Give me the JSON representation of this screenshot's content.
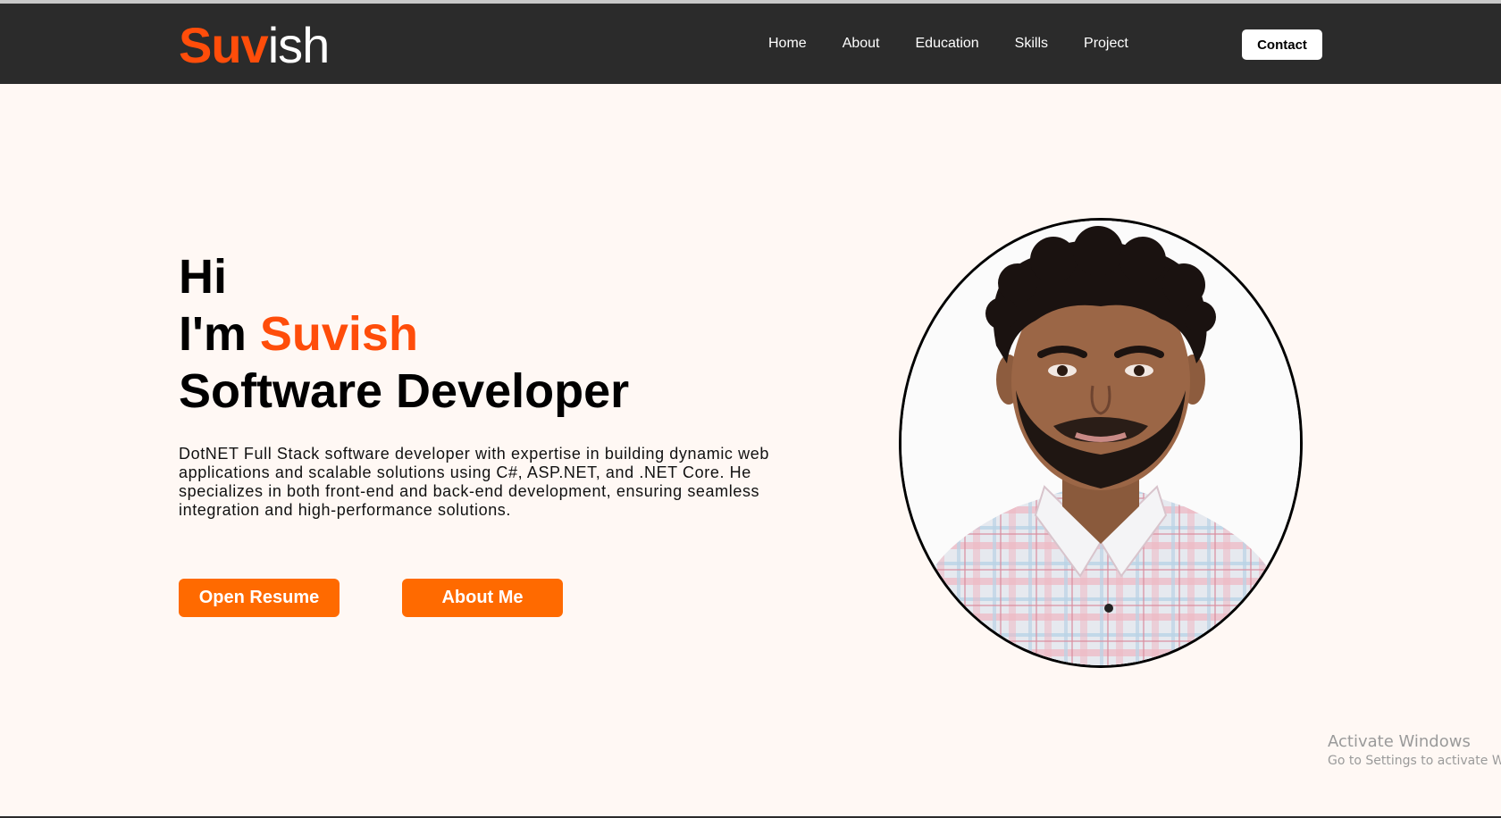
{
  "header": {
    "logo_accent": "Suv",
    "logo_rest": "ish",
    "nav": [
      "Home",
      "About",
      "Education",
      "Skills",
      "Project"
    ],
    "contact_label": "Contact"
  },
  "hero": {
    "greeting": "Hi",
    "im": "I'm ",
    "name": "Suvish",
    "role": "Software Developer",
    "description": "DotNET Full Stack software developer with expertise in building dynamic web applications and scalable solutions using C#, ASP.NET, and .NET Core. He specializes in both front-end and back-end development, ensuring seamless integration and high-performance solutions.",
    "resume_label": "Open Resume",
    "about_label": "About Me"
  },
  "watermark": {
    "line1": "Activate Windows",
    "line2": "Go to Settings to activate Windows."
  },
  "colors": {
    "accent": "#ff4d0a",
    "button": "#ff6a00",
    "navbar": "#2b2b2b",
    "background": "#fff8f4"
  }
}
